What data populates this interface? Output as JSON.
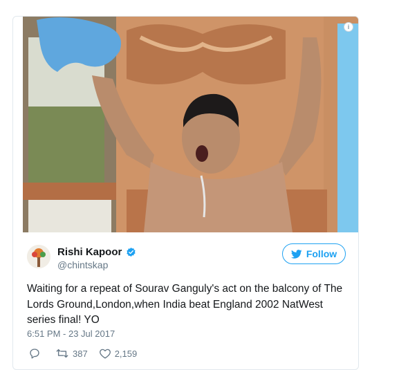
{
  "tweet": {
    "author": {
      "display_name": "Rishi Kapoor",
      "handle": "@chintskap",
      "verified": true
    },
    "follow_label": "Follow",
    "text": "Waiting for a repeat of Sourav Ganguly's act on the balcony of The Lords Ground,London,when India beat England 2002 NatWest series final! YO",
    "timestamp": "6:51 PM - 23 Jul 2017",
    "actions": {
      "reply_count": "",
      "retweet_count": "387",
      "like_count": "2,159"
    },
    "icons": [
      "info-icon",
      "verified-badge-icon",
      "twitter-bird-icon",
      "reply-icon",
      "retweet-icon",
      "like-heart-icon"
    ]
  },
  "colors": {
    "accent": "#1da1f2",
    "text_primary": "#14171a",
    "text_secondary": "#657786",
    "border": "#e1e8ed"
  }
}
